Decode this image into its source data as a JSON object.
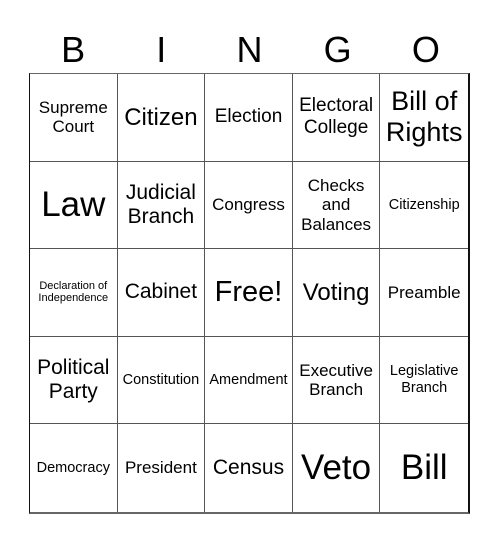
{
  "header": {
    "letters": [
      "B",
      "I",
      "N",
      "G",
      "O"
    ]
  },
  "cells": [
    "Supreme Court",
    "Citizen",
    "Election",
    "Electoral College",
    "Bill of Rights",
    "Law",
    "Judicial Branch",
    "Congress",
    "Checks and Balances",
    "Citizenship",
    "Declaration of Independence",
    "Cabinet",
    "Free!",
    "Voting",
    "Preamble",
    "Political Party",
    "Constitution",
    "Amendment",
    "Executive Branch",
    "Legislative Branch",
    "Democracy",
    "President",
    "Census",
    "Veto",
    "Bill"
  ]
}
